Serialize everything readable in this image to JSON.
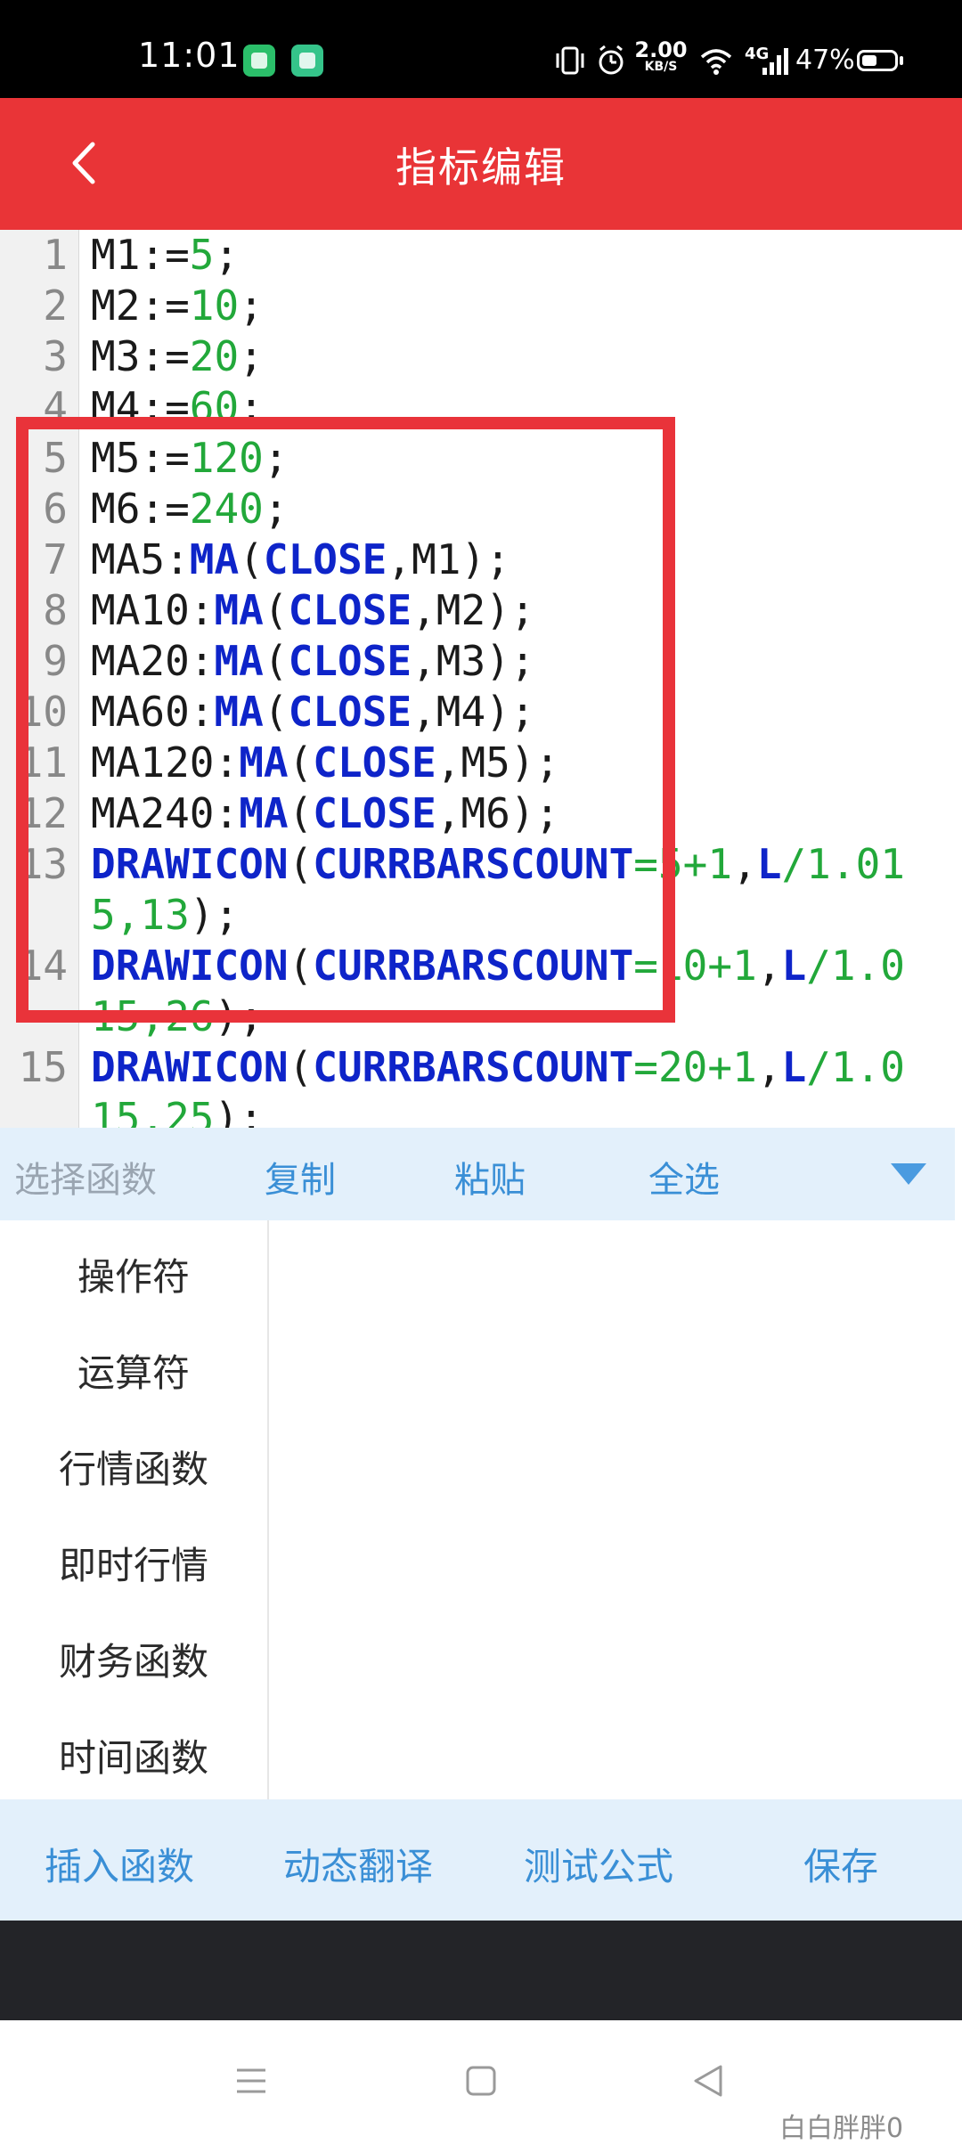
{
  "status_bar": {
    "time": "11:01",
    "net_speed_value": "2.00",
    "net_speed_unit": "KB/S",
    "network_type": "4G",
    "battery_percent": "47%",
    "battery_level": 0.47
  },
  "header": {
    "title": "指标编辑",
    "back_icon": "chevron-left-icon"
  },
  "editor": {
    "lines": [
      {
        "num": "1",
        "tokens": [
          {
            "t": "M1",
            "k": "plain"
          },
          {
            "t": ":=",
            "k": "punct"
          },
          {
            "t": "5",
            "k": "num"
          },
          {
            "t": ";",
            "k": "punct"
          }
        ]
      },
      {
        "num": "2",
        "tokens": [
          {
            "t": "M2",
            "k": "plain"
          },
          {
            "t": ":=",
            "k": "punct"
          },
          {
            "t": "10",
            "k": "num"
          },
          {
            "t": ";",
            "k": "punct"
          }
        ]
      },
      {
        "num": "3",
        "tokens": [
          {
            "t": "M3",
            "k": "plain"
          },
          {
            "t": ":=",
            "k": "punct"
          },
          {
            "t": "20",
            "k": "num"
          },
          {
            "t": ";",
            "k": "punct"
          }
        ]
      },
      {
        "num": "4",
        "tokens": [
          {
            "t": "M4",
            "k": "plain"
          },
          {
            "t": ":=",
            "k": "punct"
          },
          {
            "t": "60",
            "k": "num"
          },
          {
            "t": ";",
            "k": "punct"
          }
        ]
      },
      {
        "num": "5",
        "tokens": [
          {
            "t": "M5",
            "k": "plain"
          },
          {
            "t": ":=",
            "k": "punct"
          },
          {
            "t": "120",
            "k": "num"
          },
          {
            "t": ";",
            "k": "punct"
          }
        ]
      },
      {
        "num": "6",
        "tokens": [
          {
            "t": "M6",
            "k": "plain"
          },
          {
            "t": ":=",
            "k": "punct"
          },
          {
            "t": "240",
            "k": "num"
          },
          {
            "t": ";",
            "k": "punct"
          }
        ]
      },
      {
        "num": "7",
        "tokens": [
          {
            "t": "MA5",
            "k": "plain"
          },
          {
            "t": ":",
            "k": "punct"
          },
          {
            "t": "MA",
            "k": "fn"
          },
          {
            "t": "(",
            "k": "punct"
          },
          {
            "t": "CLOSE",
            "k": "fn"
          },
          {
            "t": ",M1",
            "k": "plain"
          },
          {
            "t": ");",
            "k": "punct"
          }
        ]
      },
      {
        "num": "8",
        "tokens": [
          {
            "t": "MA10",
            "k": "plain"
          },
          {
            "t": ":",
            "k": "punct"
          },
          {
            "t": "MA",
            "k": "fn"
          },
          {
            "t": "(",
            "k": "punct"
          },
          {
            "t": "CLOSE",
            "k": "fn"
          },
          {
            "t": ",M2",
            "k": "plain"
          },
          {
            "t": ");",
            "k": "punct"
          }
        ]
      },
      {
        "num": "9",
        "tokens": [
          {
            "t": "MA20",
            "k": "plain"
          },
          {
            "t": ":",
            "k": "punct"
          },
          {
            "t": "MA",
            "k": "fn"
          },
          {
            "t": "(",
            "k": "punct"
          },
          {
            "t": "CLOSE",
            "k": "fn"
          },
          {
            "t": ",M3",
            "k": "plain"
          },
          {
            "t": ");",
            "k": "punct"
          }
        ]
      },
      {
        "num": "10",
        "tokens": [
          {
            "t": "MA60",
            "k": "plain"
          },
          {
            "t": ":",
            "k": "punct"
          },
          {
            "t": "MA",
            "k": "fn"
          },
          {
            "t": "(",
            "k": "punct"
          },
          {
            "t": "CLOSE",
            "k": "fn"
          },
          {
            "t": ",M4",
            "k": "plain"
          },
          {
            "t": ");",
            "k": "punct"
          }
        ]
      },
      {
        "num": "11",
        "tokens": [
          {
            "t": "MA120",
            "k": "plain"
          },
          {
            "t": ":",
            "k": "punct"
          },
          {
            "t": "MA",
            "k": "fn"
          },
          {
            "t": "(",
            "k": "punct"
          },
          {
            "t": "CLOSE",
            "k": "fn"
          },
          {
            "t": ",M5",
            "k": "plain"
          },
          {
            "t": ");",
            "k": "punct"
          }
        ]
      },
      {
        "num": "12",
        "tokens": [
          {
            "t": "MA240",
            "k": "plain"
          },
          {
            "t": ":",
            "k": "punct"
          },
          {
            "t": "MA",
            "k": "fn"
          },
          {
            "t": "(",
            "k": "punct"
          },
          {
            "t": "CLOSE",
            "k": "fn"
          },
          {
            "t": ",M6",
            "k": "plain"
          },
          {
            "t": ");",
            "k": "punct"
          }
        ]
      },
      {
        "num": "13",
        "tokens": [
          {
            "t": "DRAWICON",
            "k": "fn"
          },
          {
            "t": "(",
            "k": "punct"
          },
          {
            "t": "CURRBARSCOUNT",
            "k": "fn"
          },
          {
            "t": "=5+1",
            "k": "num"
          },
          {
            "t": ",",
            "k": "punct"
          },
          {
            "t": "L",
            "k": "fn"
          },
          {
            "t": "/1.01",
            "k": "num"
          }
        ]
      },
      {
        "num": "",
        "tokens": [
          {
            "t": "5,13",
            "k": "num"
          },
          {
            "t": ");",
            "k": "punct"
          }
        ]
      },
      {
        "num": "14",
        "tokens": [
          {
            "t": "DRAWICON",
            "k": "fn"
          },
          {
            "t": "(",
            "k": "punct"
          },
          {
            "t": "CURRBARSCOUNT",
            "k": "fn"
          },
          {
            "t": "=10+1",
            "k": "num"
          },
          {
            "t": ",",
            "k": "punct"
          },
          {
            "t": "L",
            "k": "fn"
          },
          {
            "t": "/1.0",
            "k": "num"
          }
        ]
      },
      {
        "num": "",
        "tokens": [
          {
            "t": "15,26",
            "k": "num"
          },
          {
            "t": ");",
            "k": "punct"
          }
        ]
      },
      {
        "num": "15",
        "tokens": [
          {
            "t": "DRAWICON",
            "k": "fn"
          },
          {
            "t": "(",
            "k": "punct"
          },
          {
            "t": "CURRBARSCOUNT",
            "k": "fn"
          },
          {
            "t": "=20+1",
            "k": "num"
          },
          {
            "t": ",",
            "k": "punct"
          },
          {
            "t": "L",
            "k": "fn"
          },
          {
            "t": "/1.0",
            "k": "num"
          }
        ]
      },
      {
        "num": "",
        "tokens": [
          {
            "t": "15,25",
            "k": "num"
          },
          {
            "t": ");",
            "k": "punct"
          }
        ]
      }
    ],
    "colors": {
      "number": "#22a83a",
      "function": "#0e24c9",
      "highlight": "#e9333a"
    }
  },
  "toolbar": {
    "select_function": "选择函数",
    "copy": "复制",
    "paste": "粘贴",
    "select_all": "全选",
    "dropdown_icon": "triangle-down-icon"
  },
  "categories": [
    "操作符",
    "运算符",
    "行情函数",
    "即时行情",
    "财务函数",
    "时间函数"
  ],
  "bottom_actions": {
    "insert_function": "插入函数",
    "dynamic_translate": "动态翻译",
    "test_formula": "测试公式",
    "save": "保存"
  },
  "nav_bar": {
    "menu_icon": "menu-icon",
    "home_icon": "home-square-icon",
    "back_icon": "back-triangle-icon",
    "watermark": "白白胖胖0"
  },
  "theme": {
    "header_red": "#e93437",
    "accent_blue": "#3a8fd6",
    "toolbar_bg": "#e3f0fb"
  }
}
